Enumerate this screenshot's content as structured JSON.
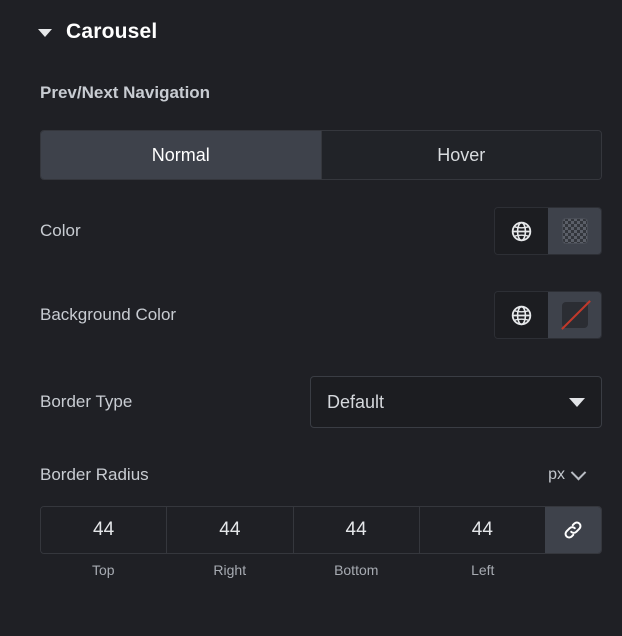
{
  "section": {
    "title": "Carousel",
    "collapse_icon": "caret-down-icon",
    "expanded": true
  },
  "subheading": "Prev/Next Navigation",
  "state_toggle": {
    "options": [
      "Normal",
      "Hover"
    ],
    "selected": "Normal"
  },
  "controls": {
    "color": {
      "label": "Color",
      "global_icon": "globe-icon",
      "swatch_type": "transparent-checkerboard"
    },
    "background_color": {
      "label": "Background Color",
      "global_icon": "globe-icon",
      "swatch_type": "none-red-slash"
    },
    "border_type": {
      "label": "Border Type",
      "value": "Default",
      "caret_icon": "chevron-down-icon"
    },
    "border_radius": {
      "label": "Border Radius",
      "unit": "px",
      "unit_caret_icon": "chevron-down-icon",
      "values": [
        "44",
        "44",
        "44",
        "44"
      ],
      "side_labels": [
        "Top",
        "Right",
        "Bottom",
        "Left"
      ],
      "link_icon": "link-icon",
      "linked": true
    }
  },
  "colors": {
    "panel_bg": "#1f2025",
    "active_segment": "#3e424b",
    "inactive_segment": "#212328",
    "border": "#35373d",
    "text": "#d5d8dc",
    "title": "#ffffff",
    "slash_red": "#c0392b"
  }
}
